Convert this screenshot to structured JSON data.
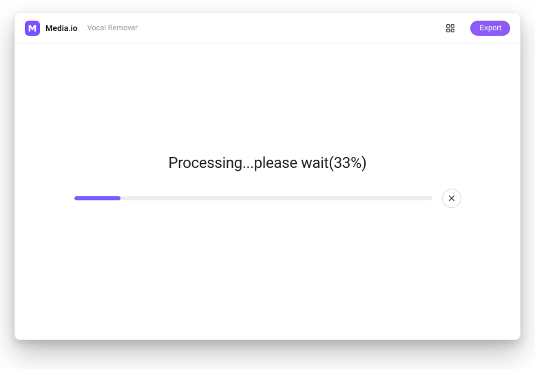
{
  "header": {
    "app_name": "Media.io",
    "subtitle": "Vocal Remover",
    "export_label": "Export"
  },
  "progress": {
    "status_prefix": "Processing...please wait(",
    "percent": 33,
    "status_suffix": "%)",
    "fill_percent": "13%"
  },
  "colors": {
    "accent": "#7c5cff",
    "export_bg": "#8b5cf6"
  }
}
